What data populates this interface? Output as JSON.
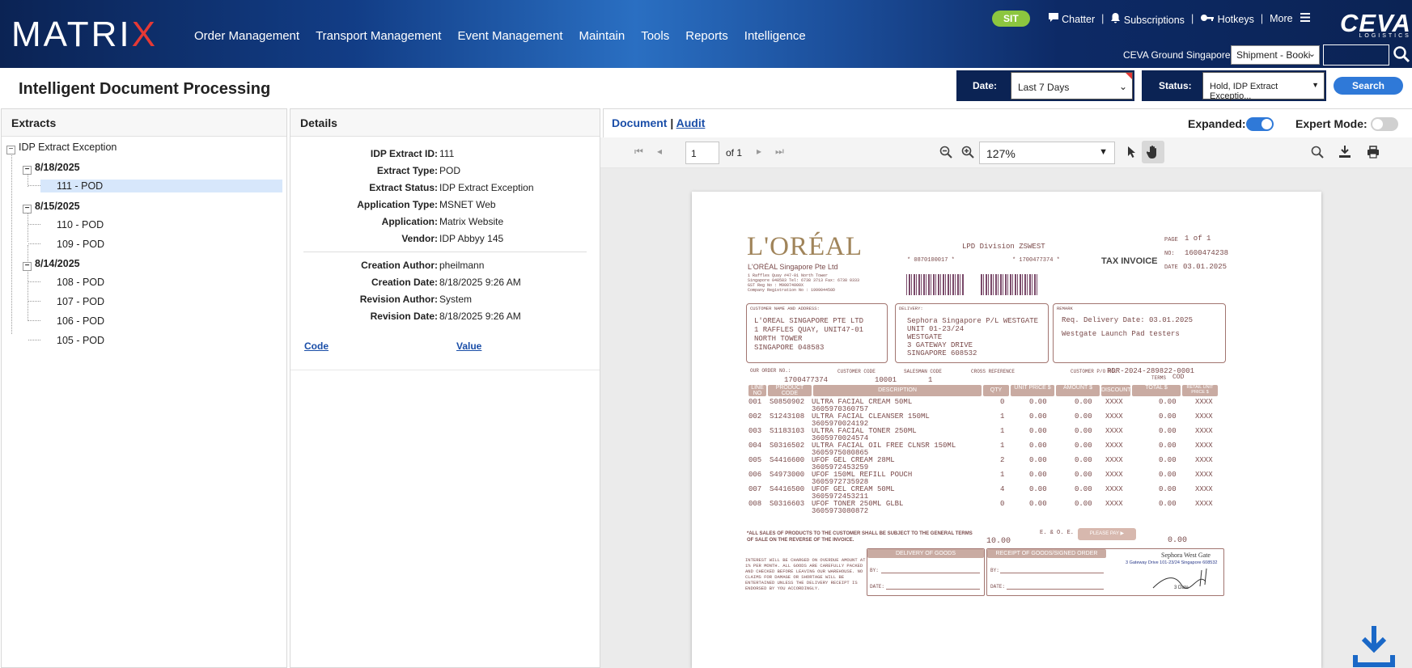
{
  "header": {
    "logo_text": "MATRI",
    "logo_x": "X",
    "nav": [
      "Order Management",
      "Transport Management",
      "Event Management",
      "Maintain",
      "Tools",
      "Reports",
      "Intelligence"
    ],
    "env_badge": "SIT",
    "links": {
      "chatter": "Chatter",
      "subscriptions": "Subscriptions",
      "hotkeys": "Hotkeys",
      "more": "More"
    },
    "brand": "CEVA",
    "brand_sub": "LOGISTICS",
    "org": "CEVA Ground Singapore",
    "search_type": "Shipment - Booki",
    "search_value": ""
  },
  "page": {
    "title": "Intelligent Document Processing",
    "date_label": "Date:",
    "date_value": "Last 7 Days",
    "status_label": "Status:",
    "status_value": "Hold, IDP Extract Exceptio...",
    "search_button": "Search"
  },
  "extracts": {
    "title": "Extracts",
    "root": "IDP Extract Exception",
    "groups": [
      {
        "date": "8/18/2025",
        "items": [
          "111 - POD"
        ]
      },
      {
        "date": "8/15/2025",
        "items": [
          "110 - POD",
          "109 - POD"
        ]
      },
      {
        "date": "8/14/2025",
        "items": [
          "108 - POD",
          "107 - POD",
          "106 - POD",
          "105 - POD"
        ]
      }
    ]
  },
  "details": {
    "title": "Details",
    "fields": [
      {
        "k": "IDP Extract ID:",
        "v": "111"
      },
      {
        "k": "Extract Type:",
        "v": "POD"
      },
      {
        "k": "Extract Status:",
        "v": "IDP Extract Exception"
      },
      {
        "k": "Application Type:",
        "v": "MSNET Web"
      },
      {
        "k": "Application:",
        "v": "Matrix Website"
      },
      {
        "k": "Vendor:",
        "v": "IDP Abbyy 145"
      }
    ],
    "audit_fields": [
      {
        "k": "Creation Author:",
        "v": "pheilmann"
      },
      {
        "k": "Creation Date:",
        "v": "8/18/2025 9:26 AM"
      },
      {
        "k": "Revision Author:",
        "v": "System"
      },
      {
        "k": "Revision Date:",
        "v": "8/18/2025 9:26 AM"
      }
    ],
    "code_col": "Code",
    "value_col": "Value"
  },
  "viewer": {
    "tab_document": "Document",
    "tab_sep": "|",
    "tab_audit": "Audit",
    "expanded_label": "Expanded:",
    "expanded_on": true,
    "expert_label": "Expert Mode:",
    "expert_on": false,
    "page_current": "1",
    "page_of": "of 1",
    "zoom": "127%"
  },
  "invoice": {
    "brand": "L'ORÉAL",
    "company": "L'ORÉAL Singapore Pte Ltd",
    "company_lines": [
      "1 Raffles Quay #47-01 North Tower",
      "Singapore 048583  Tel: 6738 3713 Fax: 6738 0333",
      "GST Reg No : M90074000X",
      "Company Registration No : 199904450D"
    ],
    "division": "LPD Division  ZSWEST",
    "ref1": "* 0870100017 *",
    "ref2": "* 1700477374 *",
    "doc_title": "TAX INVOICE",
    "page_lbl": "PAGE",
    "page_val": "1  of  1",
    "no_lbl": "NO:",
    "no_val": "1600474238",
    "date_lbl": "DATE",
    "date_val": "03.01.2025",
    "customer_hdr": "CUSTOMER NAME AND ADDRESS:",
    "customer": [
      "L'OREAL SINGAPORE PTE LTD",
      "1 RAFFLES QUAY, UNIT47-01",
      "NORTH TOWER",
      "SINGAPORE 048583"
    ],
    "delivery_hdr": "DELIVERY:",
    "delivery": [
      "Sephora Singapore P/L WESTGATE",
      "UNIT 01-23/24",
      "WESTGATE",
      "3 GATEWAY DRIVE",
      "SINGAPORE 608532"
    ],
    "remark_hdr": "REMARK",
    "remark": [
      "Req. Delivery Date: 03.01.2025",
      "Westgate Launch Pad testers"
    ],
    "order_lbl": "OUR ORDER NO.:",
    "order_no": "1700477374",
    "cust_code_lbl": "CUSTOMER CODE",
    "cust_code": "10001",
    "sales_lbl": "SALESMAN CODE",
    "sales_code": "1",
    "cross_lbl": "CROSS REFERENCE",
    "po_lbl": "CUSTOMER P/O NO.",
    "po_no": "PDR-2024-289822-0001",
    "terms_lbl": "TERMS",
    "terms": "COD",
    "cols": [
      "LINE NO",
      "PRODUCT CODE",
      "DESCRIPTION",
      "QTY",
      "UNIT PRICE $",
      "AMOUNT $",
      "DISCOUNT",
      "TOTAL $",
      "RETAIL UNIT PRICE $"
    ],
    "lines": [
      {
        "no": "001",
        "code": "S0850902",
        "desc": "ULTRA FACIAL CREAM 50ML",
        "ean": "3605970360757",
        "qty": "0",
        "up": "0.00",
        "amt": "0.00",
        "disc": "XXXX",
        "tot": "0.00",
        "rup": "XXXX"
      },
      {
        "no": "002",
        "code": "S1243108",
        "desc": "ULTRA FACIAL CLEANSER 150ML",
        "ean": "3605970024192",
        "qty": "1",
        "up": "0.00",
        "amt": "0.00",
        "disc": "XXXX",
        "tot": "0.00",
        "rup": "XXXX"
      },
      {
        "no": "003",
        "code": "S1183103",
        "desc": "ULTRA FACIAL TONER 250ML",
        "ean": "3605970024574",
        "qty": "1",
        "up": "0.00",
        "amt": "0.00",
        "disc": "XXXX",
        "tot": "0.00",
        "rup": "XXXX"
      },
      {
        "no": "004",
        "code": "S0316502",
        "desc": "ULTRA FACIAL OIL FREE CLNSR 150ML",
        "ean": "3605975080865",
        "qty": "1",
        "up": "0.00",
        "amt": "0.00",
        "disc": "XXXX",
        "tot": "0.00",
        "rup": "XXXX"
      },
      {
        "no": "005",
        "code": "S4416600",
        "desc": "UFOF GEL CREAM 28ML",
        "ean": "3605972453259",
        "qty": "2",
        "up": "0.00",
        "amt": "0.00",
        "disc": "XXXX",
        "tot": "0.00",
        "rup": "XXXX"
      },
      {
        "no": "006",
        "code": "S4973000",
        "desc": "UFOF 150ML REFILL POUCH",
        "ean": "3605972735928",
        "qty": "1",
        "up": "0.00",
        "amt": "0.00",
        "disc": "XXXX",
        "tot": "0.00",
        "rup": "XXXX"
      },
      {
        "no": "007",
        "code": "S4416500",
        "desc": "UFOF GEL CREAM 50ML",
        "ean": "3605972453211",
        "qty": "4",
        "up": "0.00",
        "amt": "0.00",
        "disc": "XXXX",
        "tot": "0.00",
        "rup": "XXXX"
      },
      {
        "no": "008",
        "code": "S0316603",
        "desc": "UFOF TONER 250ML GLBL",
        "ean": "3605973080872",
        "qty": "0",
        "up": "0.00",
        "amt": "0.00",
        "disc": "XXXX",
        "tot": "0.00",
        "rup": "XXXX"
      }
    ],
    "terms_note": "*ALL SALES OF PRODUCTS TO THE CUSTOMER SHALL BE SUBJECT TO THE GENERAL TERMS OF SALE ON THE REVERSE OF THE INVOICE.",
    "qty_total": "10.00",
    "eoe": "E. & O. E.",
    "please_pay": "PLEASE PAY ▶",
    "grand_total": "0.00",
    "interest_note": "INTEREST WILL BE CHARGED ON OVERDUE AMOUNT AT 1% PER MONTH. ALL GOODS ARE CAREFULLY PACKED AND CHECKED BEFORE LEAVING OUR WAREHOUSE. NO CLAIMS FOR DAMAGE OR SHORTAGE WILL BE ENTERTAINED UNLESS THE DELIVERY RECEIPT IS ENDORSED BY YOU ACCORDINGLY.",
    "delivery_goods": "DELIVERY OF GOODS",
    "receipt_goods": "RECEIPT OF GOODS/SIGNED ORDER",
    "by_lbl": "BY:",
    "date_lbl2": "DATE:",
    "stamp": "Sephora West Gate",
    "stamp_addr": "3 Gateway Drive 101-23/24 Singapore 608532",
    "stamp_date": "3 Date"
  }
}
